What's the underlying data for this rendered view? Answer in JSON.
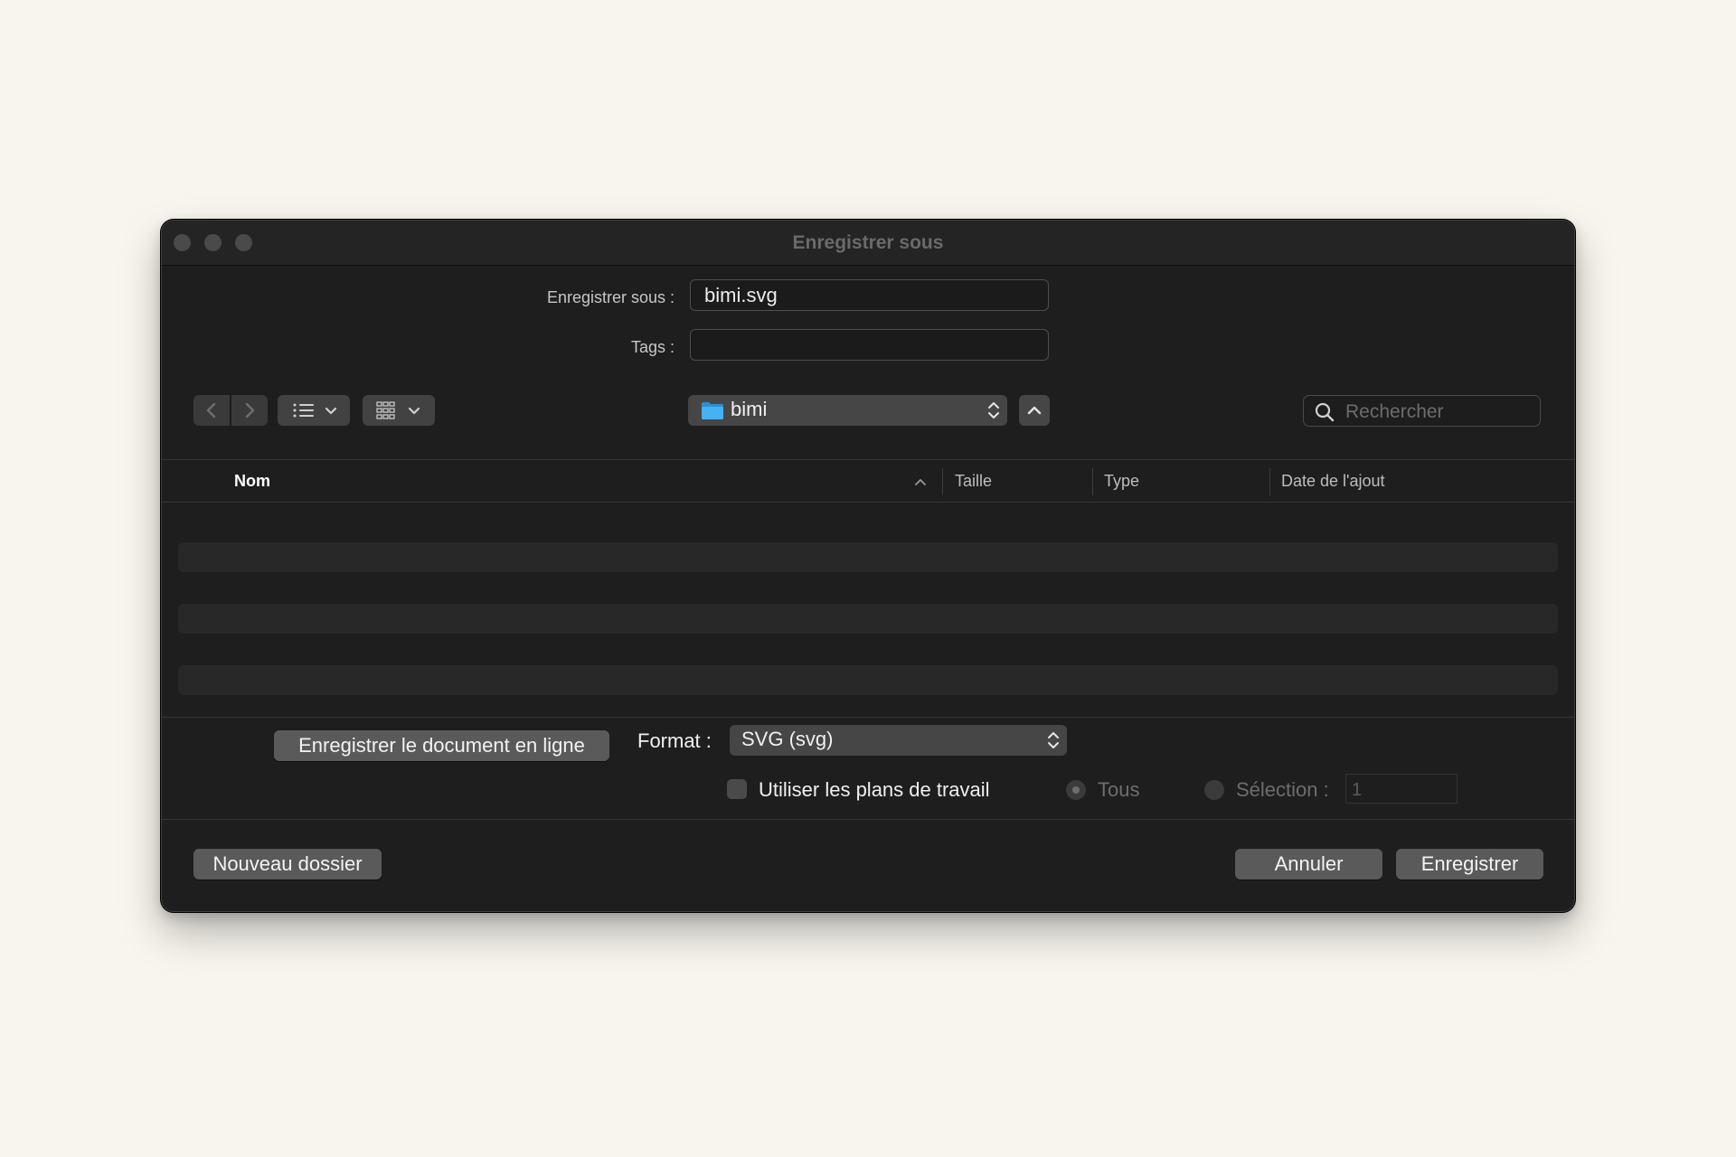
{
  "window": {
    "title": "Enregistrer sous"
  },
  "form": {
    "save_as_label": "Enregistrer sous :",
    "save_as_value": "bimi.svg",
    "tags_label": "Tags :",
    "tags_value": ""
  },
  "toolbar": {
    "location": "bimi",
    "search_placeholder": "Rechercher"
  },
  "file_list": {
    "columns": [
      "Nom",
      "Taille",
      "Type",
      "Date de l'ajout"
    ],
    "sort_column": "Nom",
    "rows": []
  },
  "options": {
    "online_button": "Enregistrer le document en ligne",
    "format_label": "Format :",
    "format_value": "SVG (svg)",
    "artboards_label": "Utiliser les plans de travail",
    "artboards_checked": false,
    "all_label": "Tous",
    "selection_label": "Sélection :",
    "selection_value": "1"
  },
  "footer": {
    "new_folder": "Nouveau dossier",
    "cancel": "Annuler",
    "save": "Enregistrer"
  },
  "colors": {
    "background": "#f8f5ee",
    "window": "#1e1e1e",
    "folder": "#3aa7ec"
  }
}
